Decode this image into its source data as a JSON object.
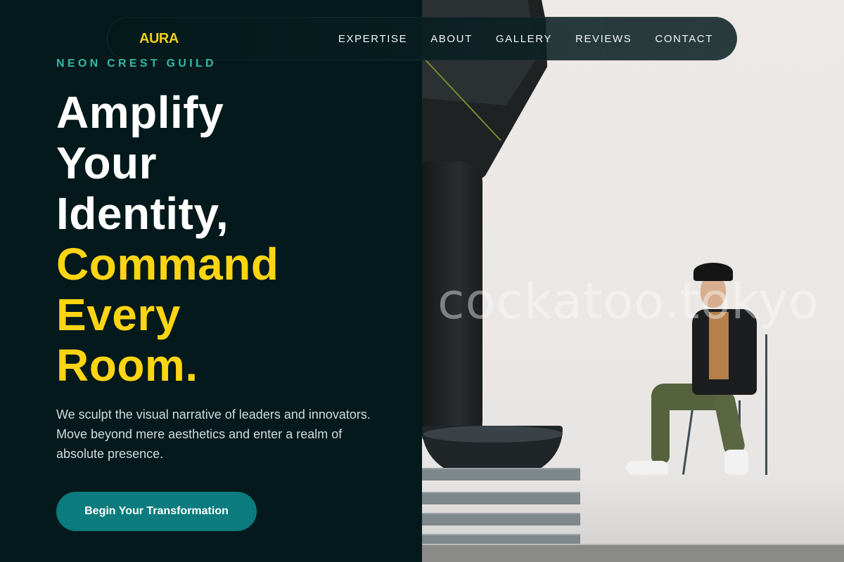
{
  "header": {
    "brand": "AURA",
    "nav": [
      {
        "label": "EXPERTISE"
      },
      {
        "label": "ABOUT"
      },
      {
        "label": "GALLERY"
      },
      {
        "label": "REVIEWS"
      },
      {
        "label": "CONTACT"
      }
    ]
  },
  "hero": {
    "eyebrow": "NEON CREST GUILD",
    "headline_white": [
      "Amplify",
      "Your",
      "Identity,"
    ],
    "headline_gold": [
      "Command",
      "Every",
      "Room."
    ],
    "description": "We sculpt the visual narrative of leaders and innovators. Move beyond mere aesthetics and enter a realm of absolute presence.",
    "cta_label": "Begin Your Transformation"
  },
  "photo": {
    "watermark": "cockatoo.tokyo"
  },
  "colors": {
    "background": "#03191b",
    "accent_gold": "#fdd512",
    "accent_teal": "#34b9a8",
    "button": "#0b7b7d"
  }
}
